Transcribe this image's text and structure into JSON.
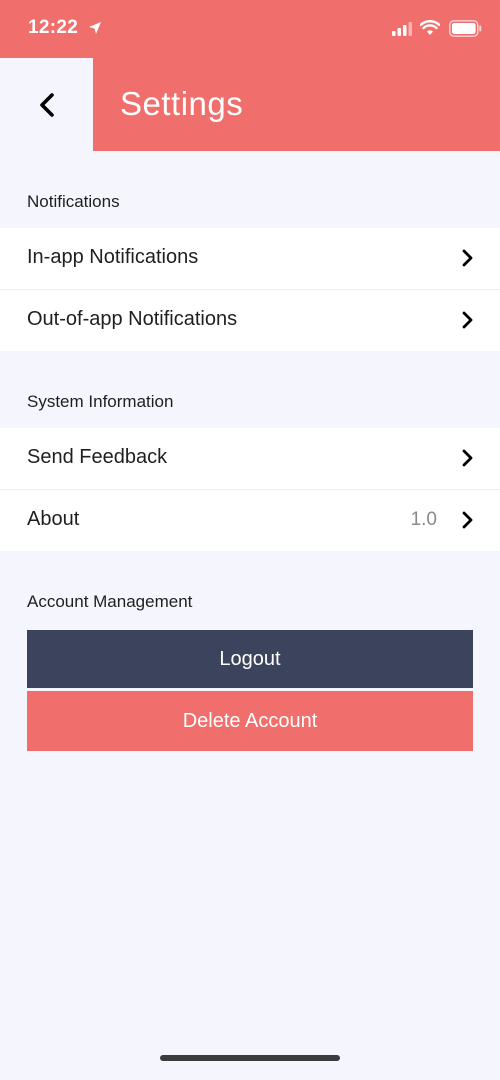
{
  "status_bar": {
    "time": "12:22",
    "icons": [
      "location-arrow-icon",
      "signal-icon",
      "wifi-icon",
      "battery-icon"
    ]
  },
  "header": {
    "back_icon": "chevron-left-icon",
    "title": "Settings"
  },
  "sections": {
    "notifications": {
      "title": "Notifications",
      "items": [
        {
          "label": "In-app Notifications",
          "icon": "chevron-right-icon"
        },
        {
          "label": "Out-of-app Notifications",
          "icon": "chevron-right-icon"
        }
      ]
    },
    "system_information": {
      "title": "System Information",
      "items": [
        {
          "label": "Send Feedback",
          "icon": "chevron-right-icon"
        },
        {
          "label": "About",
          "value": "1.0",
          "icon": "chevron-right-icon"
        }
      ]
    },
    "account_management": {
      "title": "Account Management",
      "logout_label": "Logout",
      "delete_label": "Delete Account"
    }
  },
  "colors": {
    "accent": "#f06e6b",
    "dark_button": "#3b445c",
    "background": "#f5f6fd"
  }
}
